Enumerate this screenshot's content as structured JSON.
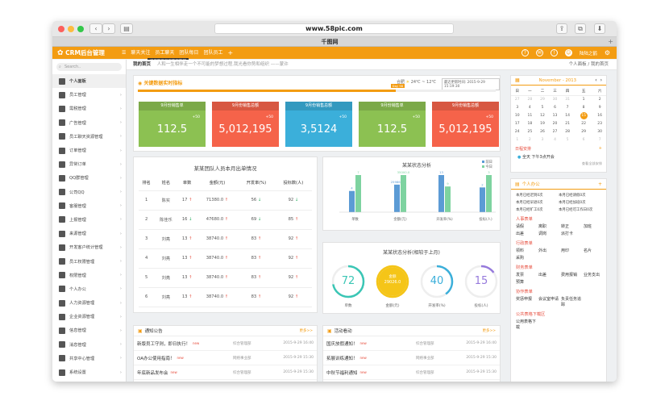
{
  "browser": {
    "url": "www.58pic.com",
    "tab_title": "千图网"
  },
  "app": {
    "brand": "CRM后台管理",
    "menu": [
      "聊天关注",
      "员工聊天",
      "团队每日",
      "团队员工"
    ],
    "tooltip": "员工聊天员工聊天管理",
    "user": "陆陆之鹤"
  },
  "breadcrumb": {
    "home": "我的首页",
    "notice": "人和一生相伴走一个不可能的梦想过程,我光看你势和组织 ——蒙许",
    "right": "个人面板 / 我的首页"
  },
  "sidebar": {
    "search_placeholder": "Search..",
    "items": [
      "个人面板",
      "员工管理",
      "需税管理",
      "广告管理",
      "员工聊天资源管理",
      "订单管理",
      "异常订单",
      "QQ群管理",
      "公司QQ",
      "客服管理",
      "上报管理",
      "来源管理",
      "开发客户统计管理",
      "员工权限管理",
      "权限管理",
      "个人办公",
      "人力资源管理",
      "企业资源管理",
      "信息管理",
      "消息管理",
      "共享中心管理",
      "系统设置"
    ]
  },
  "kpi": {
    "title": "关键数据实时指标",
    "weather": "24℃ ~ 12℃",
    "location": "合肥",
    "updated": "最近更新时间: 2015-9-29 15:19:30",
    "progress_label": "Day 98",
    "progress": 0.72,
    "cards": [
      {
        "title": "9月份销售单",
        "value": "112.5",
        "plus": "+50",
        "color": "#8cc152"
      },
      {
        "title": "9月份销售总额",
        "value": "5,012,195",
        "plus": "+50",
        "color": "#f5634a"
      },
      {
        "title": "9月份销售总额",
        "value": "3,5124",
        "plus": "+50",
        "color": "#3bafda"
      },
      {
        "title": "9月份销售单",
        "value": "112.5",
        "plus": "+50",
        "color": "#8cc152"
      },
      {
        "title": "9月份销售总额",
        "value": "5,012,195",
        "plus": "+50",
        "color": "#f5634a"
      }
    ]
  },
  "order_table": {
    "title": "某某团队人员本月出单情况",
    "headers": [
      "排名",
      "姓名",
      "单数",
      "金额(元)",
      "开发率(%)",
      "投标数(人)"
    ],
    "rows": [
      [
        "1",
        "陈实",
        "17",
        "71380.0",
        "56",
        "92"
      ],
      [
        "2",
        "陈佳乐",
        "16",
        "47680.0",
        "69",
        "85"
      ],
      [
        "3",
        "刘亮",
        "13",
        "38740.0",
        "83",
        "92"
      ],
      [
        "4",
        "刘亮",
        "13",
        "38740.0",
        "83",
        "92"
      ],
      [
        "5",
        "刘亮",
        "13",
        "38740.0",
        "83",
        "92"
      ],
      [
        "6",
        "刘亮",
        "13",
        "38740.0",
        "83",
        "92"
      ]
    ],
    "trends": [
      [
        "up",
        "down",
        "down"
      ],
      [
        "down",
        "down",
        "up"
      ],
      [
        "up",
        "up",
        "up"
      ],
      [
        "up",
        "up",
        "up"
      ],
      [
        "up",
        "up",
        "up"
      ],
      [
        "up",
        "up",
        "up"
      ]
    ]
  },
  "chart_data": {
    "type": "bar",
    "title": "某某状态分析",
    "categories": [
      "单数",
      "金额(元)",
      "开发率(%)",
      "投标(人)"
    ],
    "series": [
      {
        "name": "前日",
        "values": [
          4,
          25986,
          13,
          2
        ],
        "color": "#5b9bd5"
      },
      {
        "name": "今日",
        "values": [
          7,
          35000,
          9,
          3
        ],
        "color": "#7ed3a0"
      }
    ],
    "labels": [
      [
        "4",
        "7"
      ],
      [
        "25986.0",
        "35000.0"
      ],
      [
        "13",
        "9"
      ],
      [
        "2",
        "3"
      ]
    ]
  },
  "status_rings": {
    "title": "某某状态分析(相较于上月)",
    "items": [
      {
        "value": "72",
        "label": "单数",
        "color": "#3ac6b5",
        "fill": 0.72
      },
      {
        "value": "29026.0",
        "sub": "金额",
        "label": "金额(元)",
        "color": "#f5c518",
        "fill": 1
      },
      {
        "value": "40",
        "label": "开发率(%)",
        "color": "#3bafda",
        "fill": 0.4
      },
      {
        "value": "15",
        "label": "投标(人)",
        "color": "#967adc",
        "fill": 0.15
      }
    ]
  },
  "notice": {
    "title": "通知公告",
    "more": "更多>>",
    "rows": [
      {
        "text": "新版员工守则，即日执行！",
        "dept": "综合管理部",
        "time": "2015-9-29 16:40"
      },
      {
        "text": "OA办公使用指南！",
        "dept": "网络事业部",
        "time": "2015-9-29 15:30"
      },
      {
        "text": "年底新品发布会",
        "dept": "综合管理部",
        "time": "2015-9-29 15:30"
      }
    ]
  },
  "activity": {
    "title": "活动看动",
    "more": "更多>>",
    "rows": [
      {
        "text": "国庆放假通知！",
        "dept": "综合管理部",
        "time": "2015-9-29 16:40"
      },
      {
        "text": "拓展训练通知！",
        "dept": "网络事业部",
        "time": "2015-9-29 15:30"
      },
      {
        "text": "中秋节福利通知",
        "dept": "综合管理部",
        "time": "2015-9-29 15:30"
      }
    ]
  },
  "calendar": {
    "month": "November - 2013",
    "weekdays": [
      "日",
      "一",
      "二",
      "三",
      "四",
      "五",
      "六"
    ],
    "weeks": [
      [
        "27",
        "28",
        "29",
        "30",
        "31",
        "1",
        "2"
      ],
      [
        "3",
        "4",
        "5",
        "6",
        "7",
        "8",
        "9"
      ],
      [
        "10",
        "11",
        "12",
        "13",
        "14",
        "15",
        "16"
      ],
      [
        "17",
        "18",
        "19",
        "20",
        "21",
        "22",
        "23"
      ],
      [
        "24",
        "25",
        "26",
        "27",
        "28",
        "29",
        "30"
      ],
      [
        "1",
        "2",
        "3",
        "4",
        "5",
        "6",
        "7"
      ]
    ],
    "today": "15",
    "schedule_title": "日程安排",
    "schedule_item": "全天  下午3点开会",
    "schedule_link": "查看全部安排"
  },
  "office": {
    "title": "个人办公",
    "stats": [
      "本月已经迟到0次",
      "本月已经请假0次",
      "本月已经早退0次",
      "本月已经加班0次",
      "本月已经旷工0次",
      "本月已经可工作日0次"
    ],
    "groups": [
      {
        "title": "人事表单",
        "items": [
          "请假",
          "离职",
          "转正",
          "加班",
          "出差",
          "调岗",
          "派打卡"
        ]
      },
      {
        "title": "行政表单",
        "items": [
          "领料",
          "外出",
          "用印",
          "名片",
          "采购"
        ]
      },
      {
        "title": "财务表单",
        "items": [
          "发票",
          "出差",
          "费用报销",
          "业务支出",
          "预算"
        ]
      },
      {
        "title": "协作表单",
        "items": [
          "奖惩申报",
          "会议室申请",
          "负责任务追踪"
        ]
      },
      {
        "title": "公共表格下载区",
        "items": [
          "公用表格下载"
        ]
      }
    ]
  }
}
